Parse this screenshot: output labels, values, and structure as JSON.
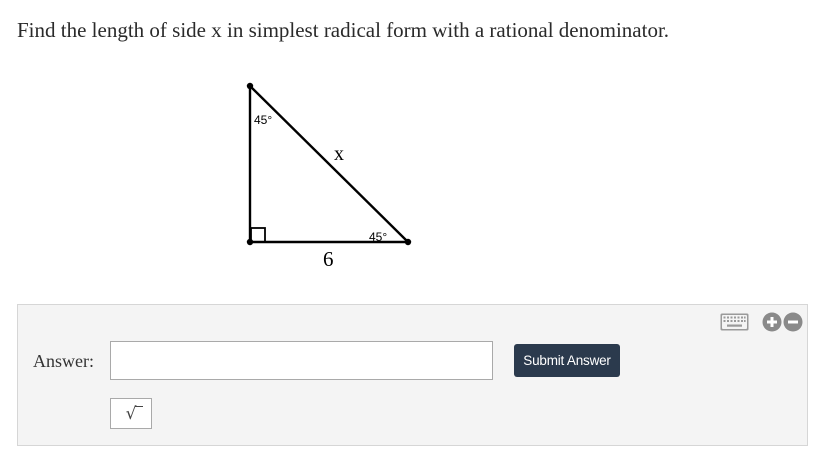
{
  "question": {
    "text": "Find the length of side x in simplest radical form with a rational denominator."
  },
  "figure": {
    "top_angle_label": "45°",
    "bottom_angle_label": "45°",
    "hypotenuse_label": "x",
    "base_label": "6"
  },
  "answer": {
    "label": "Answer:",
    "input_value": "",
    "submit_label": "Submit Answer",
    "sqrt_button_symbol": "√"
  },
  "toolbar": {
    "icons": [
      "keyboard-icon",
      "zoom-in-icon",
      "zoom-out-icon"
    ]
  },
  "colors": {
    "submit_bg": "#2b3a4d",
    "panel_bg": "#f4f4f4",
    "icon_gray": "#8a8a8a"
  }
}
